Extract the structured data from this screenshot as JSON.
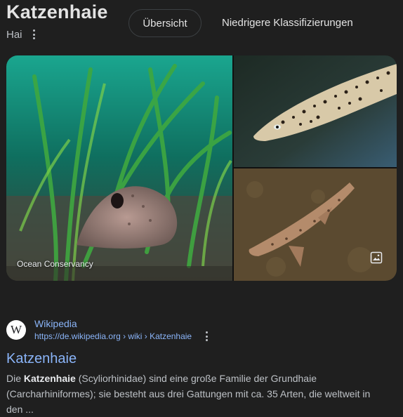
{
  "header": {
    "title": "Katzenhaie",
    "subtitle": "Hai",
    "tabs": [
      {
        "label": "Übersicht",
        "active": true
      },
      {
        "label": "Niedrigere Klassifizierungen",
        "active": false
      }
    ]
  },
  "gallery": {
    "credit": "Ocean Conservancy",
    "more_icon": "image-icon"
  },
  "result": {
    "site_name": "Wikipedia",
    "favicon_letter": "W",
    "url": "https://de.wikipedia.org › wiki › Katzenhaie",
    "title": "Katzenhaie",
    "snippet_prefix": "Die ",
    "snippet_bold": "Katzenhaie",
    "snippet_rest": " (Scyliorhinidae) sind eine große Familie der Grundhaie (Carcharhiniformes); sie besteht aus drei Gattungen mit ca. 35 Arten, die weltweit in den ..."
  },
  "colors": {
    "background": "#1f1f1f",
    "link": "#8ab4f8",
    "text": "#bdc1c6"
  }
}
